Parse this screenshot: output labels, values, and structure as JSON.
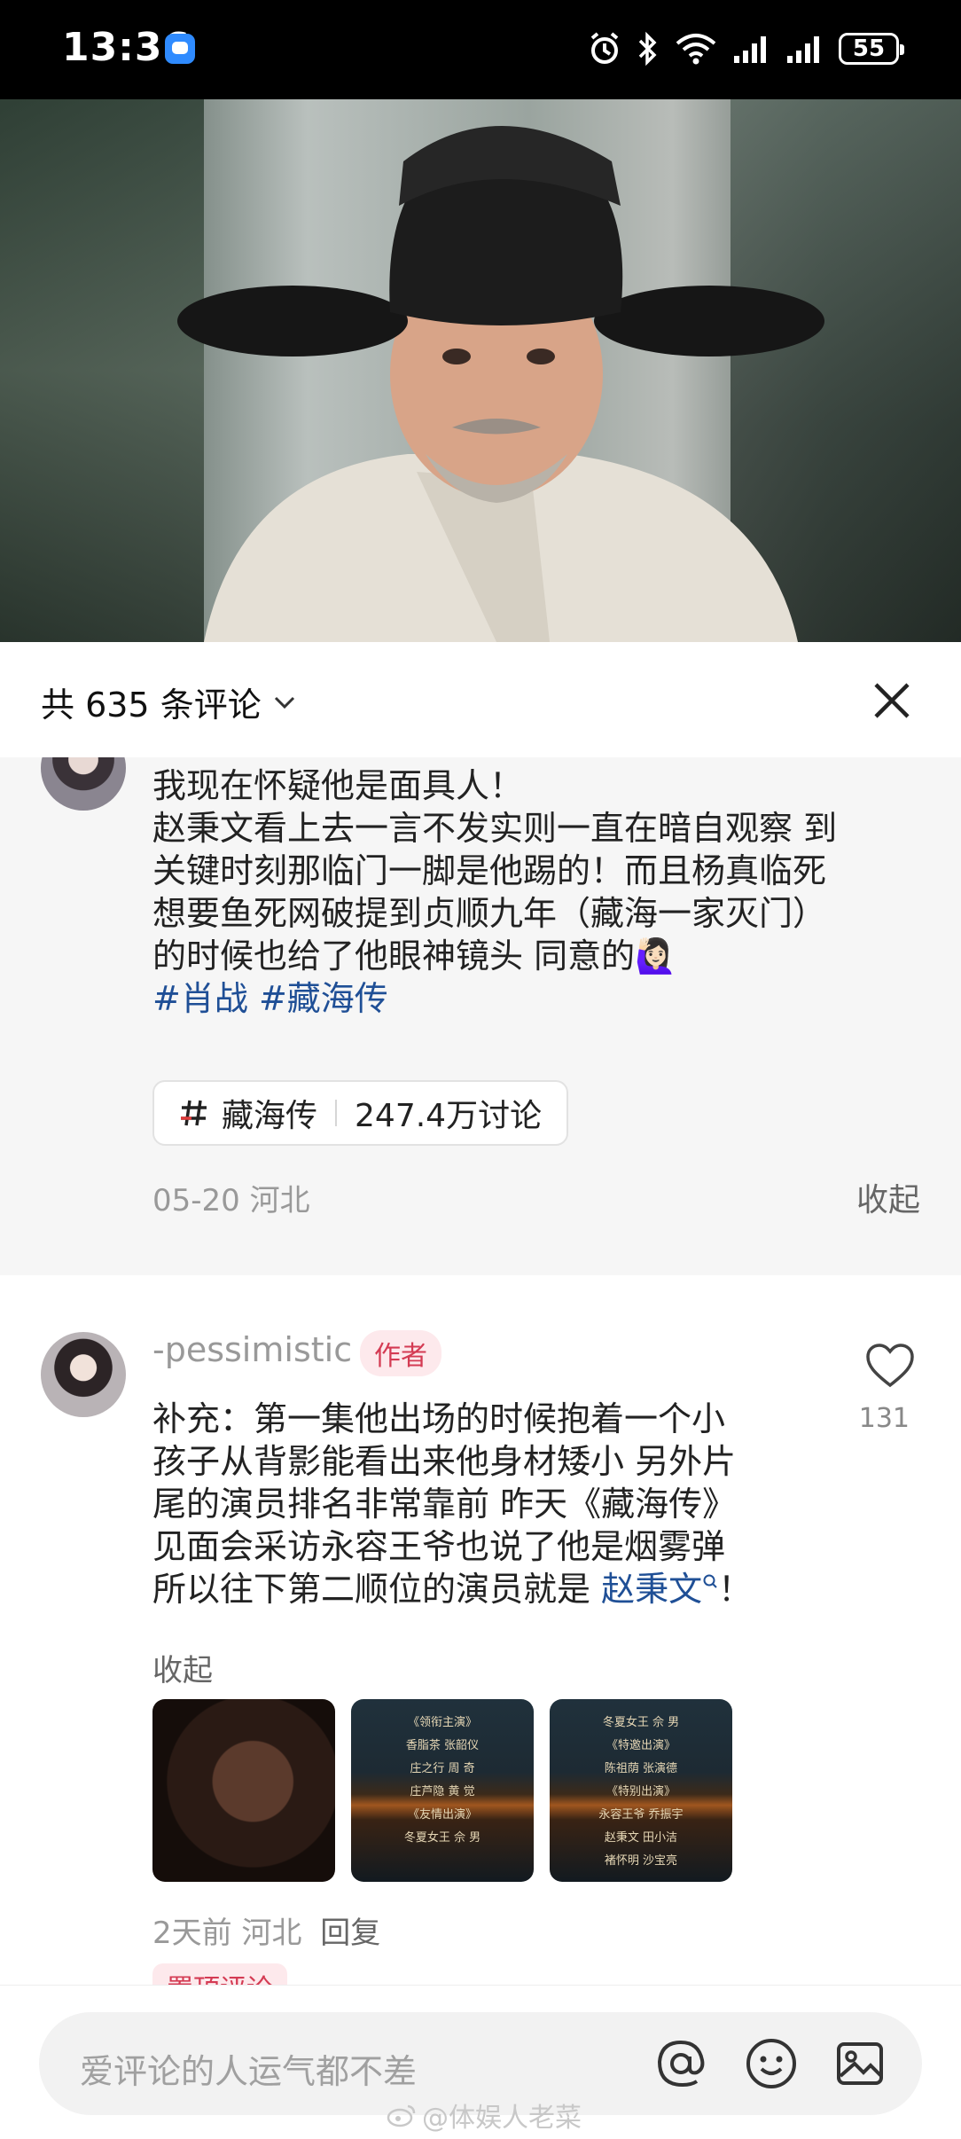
{
  "status_bar": {
    "time": "13:36",
    "battery": "55"
  },
  "sheet": {
    "comment_count_label": "共 635 条评论",
    "pinned_comment": {
      "lines": [
        "我现在怀疑他是面具人！",
        "赵秉文看上去一言不发实则一直在暗自观察  到",
        "关键时刻那临门一脚是他踢的！而且杨真临死",
        "想要鱼死网破提到贞顺九年（藏海一家灭门）",
        "的时候也给了他眼神镜头  同意的"
      ],
      "emoji": "🙋🏻‍♀️",
      "hashtags": [
        "#肖战",
        "#藏海传"
      ],
      "topic_name": "藏海传",
      "topic_discussions": "247.4万讨论",
      "date_location": "05-20 河北",
      "collapse_label": "收起"
    },
    "reply": {
      "username": "-pessimistic",
      "author_badge": "作者",
      "likes": "131",
      "lines": [
        "补充：第一集他出场的时候抱着一个小",
        "孩子从背影能看出来他身材矮小  另外片",
        "尾的演员排名非常靠前  昨天《藏海传》",
        "见面会采访永容王爷也说了他是烟雾弹"
      ],
      "last_line_prefix": "所以往下第二顺位的演员就是 ",
      "mention": "赵秉文",
      "last_line_suffix": "！",
      "collapse_label": "收起",
      "meta_time_location": "2天前 河北",
      "reply_label": "回复",
      "thumbnails": [
        {
          "alt": "dark film still"
        },
        {
          "credits": [
            "《领衔主演》",
            "香脂茶    张韶仪",
            "庄之行    周 奇",
            "庄芦隐    黄 觉",
            "《友情出演》",
            "冬夏女王    佘 男"
          ]
        },
        {
          "credits": [
            "冬夏女王    佘 男",
            "《特邀出演》",
            "陈祖荫    张演德",
            "《特别出演》",
            "永容王爷    乔振宇",
            "赵秉文    田小洁",
            "褚怀明    沙宝亮"
          ]
        }
      ]
    },
    "next_badge": "置顶评论"
  },
  "input_bar": {
    "placeholder": "爱评论的人运气都不差",
    "watermark": "@体娱人老菜"
  },
  "colors": {
    "link": "#1f4f96",
    "author_badge_bg": "#fde9ec",
    "author_badge_text": "#d43b53"
  }
}
